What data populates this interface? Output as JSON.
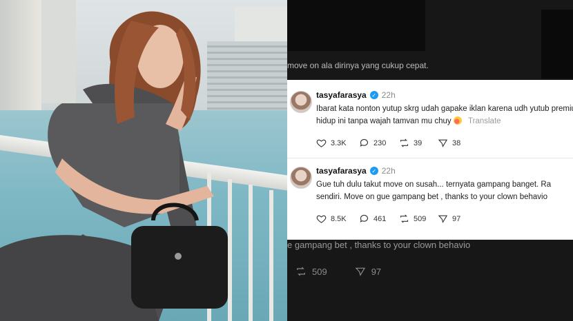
{
  "background": {
    "caption_line": "move on ala dirinya yang cukup cepat.",
    "blurred_line": "e gampang bet , thanks to your clown behavio",
    "blurred_stats": {
      "retweets": "509",
      "likes": "97"
    }
  },
  "tweets": [
    {
      "username": "tasyafarasya",
      "time": "22h",
      "text_line1": "Ibarat kata nonton yutup skrg udah gapake iklan karena udh yutub premium",
      "text_line2": "hidup ini tanpa wajah tamvan mu chuy",
      "translate_label": "Translate",
      "likes": "3.3K",
      "replies": "230",
      "retweets": "39",
      "views": "38"
    },
    {
      "username": "tasyafarasya",
      "time": "22h",
      "text_line1": "Gue tuh dulu takut move on susah... ternyata gampang banget. Ra",
      "text_line2": "sendiri. Move on gue gampang bet , thanks to your clown behavio",
      "likes": "8.5K",
      "replies": "461",
      "retweets": "509",
      "views": "97"
    }
  ],
  "colors": {
    "verified": "#1d9bf0",
    "card_bg": "#ffffff",
    "page_bg": "#171717"
  }
}
